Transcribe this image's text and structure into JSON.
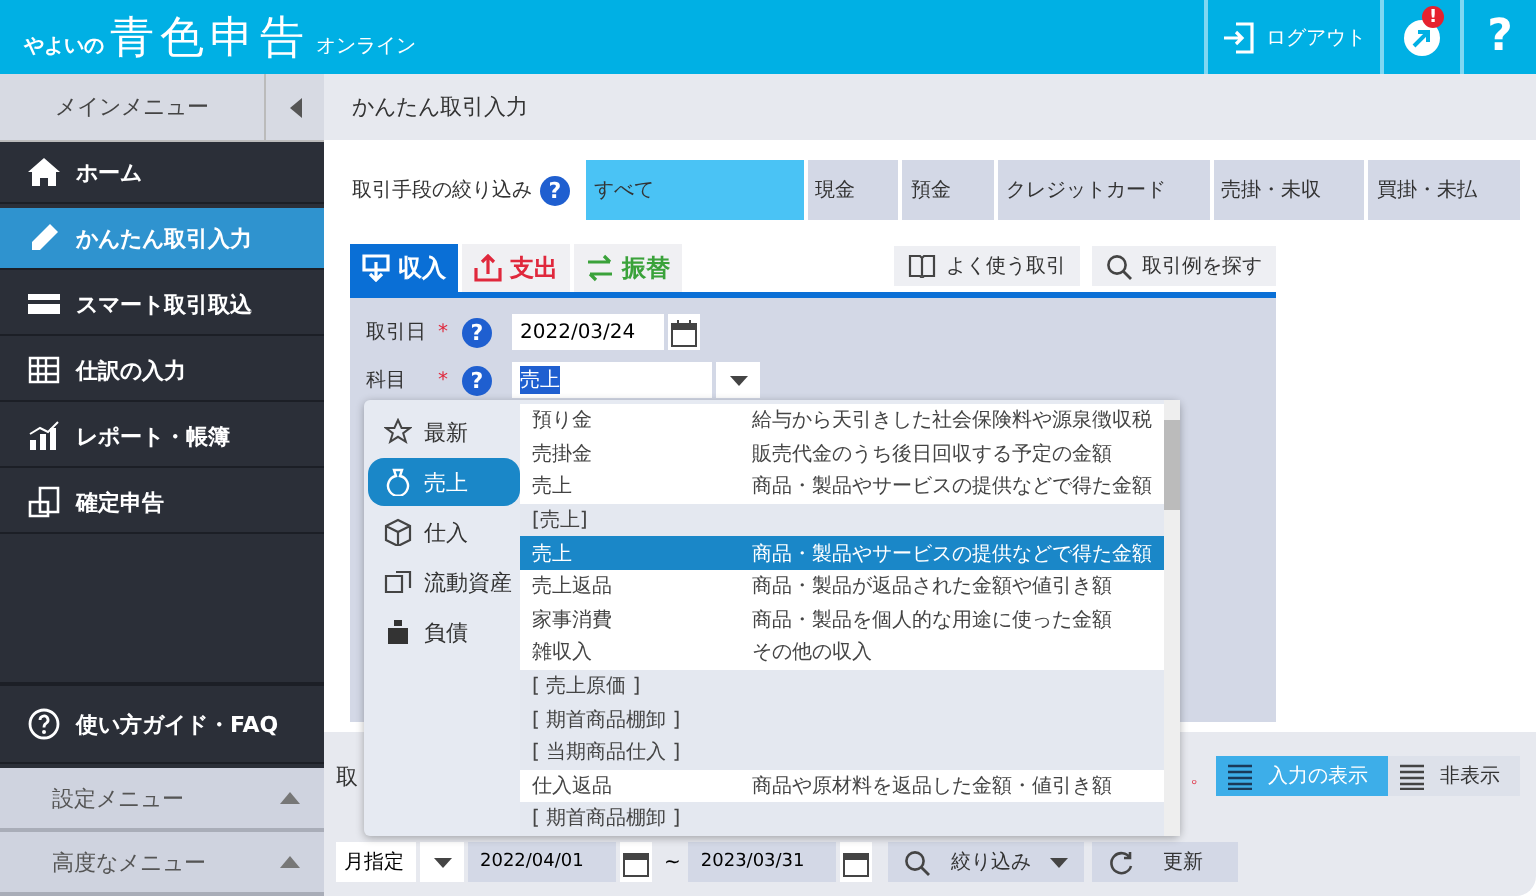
{
  "header": {
    "logo_prefix": "やよいの",
    "logo_main": "青色申告",
    "logo_suffix": "オンライン",
    "logout": "ログアウト",
    "notification_badge": "!",
    "help": "?"
  },
  "sidebar": {
    "title": "メインメニュー",
    "items": [
      {
        "label": "ホーム",
        "selected": false
      },
      {
        "label": "かんたん取引入力",
        "selected": true
      },
      {
        "label": "スマート取引取込",
        "selected": false
      },
      {
        "label": "仕訳の入力",
        "selected": false
      },
      {
        "label": "レポート・帳簿",
        "selected": false
      },
      {
        "label": "確定申告",
        "selected": false
      }
    ],
    "guide": "使い方ガイド・FAQ",
    "menus": [
      "設定メニュー",
      "高度なメニュー"
    ]
  },
  "page_title": "かんたん取引入力",
  "filter": {
    "label": "取引手段の絞り込み",
    "help": "?",
    "options": [
      {
        "label": "すべて",
        "selected": true
      },
      {
        "label": "現金",
        "selected": false
      },
      {
        "label": "預金",
        "selected": false
      },
      {
        "label": "クレジットカード",
        "selected": false
      },
      {
        "label": "売掛・未収",
        "selected": false
      },
      {
        "label": "買掛・未払",
        "selected": false
      }
    ]
  },
  "entry_tabs": [
    {
      "label": "収入",
      "kind": "income",
      "selected": true
    },
    {
      "label": "支出",
      "kind": "expense",
      "selected": false
    },
    {
      "label": "振替",
      "kind": "transfer",
      "selected": false
    }
  ],
  "quick_buttons": [
    "よく使う取引",
    "取引例を探す"
  ],
  "form": [
    {
      "label": "取引日",
      "mark": "*",
      "help": "?",
      "value": "2022/03/24",
      "kind": "date"
    },
    {
      "label": "科目",
      "mark": "*",
      "help": "?",
      "value": "売上",
      "kind": "select"
    }
  ],
  "dropdown": {
    "categories": [
      {
        "label": "最新",
        "selected": false
      },
      {
        "label": "売上",
        "selected": true
      },
      {
        "label": "仕入",
        "selected": false
      },
      {
        "label": "流動資産",
        "selected": false
      },
      {
        "label": "負債",
        "selected": false
      }
    ],
    "rows": [
      {
        "kind": "item",
        "name": "預り金",
        "description": "給与から天引きした社会保険料や源泉徴収税",
        "selected": false
      },
      {
        "kind": "item",
        "name": "売掛金",
        "description": "販売代金のうち後日回収する予定の金額",
        "selected": false
      },
      {
        "kind": "item",
        "name": "売上",
        "description": "商品・製品やサービスの提供などで得た金額",
        "selected": false
      },
      {
        "kind": "group",
        "name": "[売上]",
        "selected": false
      },
      {
        "kind": "item",
        "name": "売上",
        "description": "商品・製品やサービスの提供などで得た金額",
        "selected": true
      },
      {
        "kind": "item",
        "name": "売上返品",
        "description": "商品・製品が返品された金額や値引き額",
        "selected": false
      },
      {
        "kind": "item",
        "name": "家事消費",
        "description": "商品・製品を個人的な用途に使った金額",
        "selected": false
      },
      {
        "kind": "item",
        "name": "雑収入",
        "description": "その他の収入",
        "selected": false
      },
      {
        "kind": "group",
        "name": "[ 売上原価 ]",
        "selected": false
      },
      {
        "kind": "group",
        "name": "[ 期首商品棚卸 ]",
        "selected": false
      },
      {
        "kind": "group",
        "name": "[ 当期商品仕入 ]",
        "selected": false
      },
      {
        "kind": "item",
        "name": "仕入返品",
        "description": "商品や原材料を返品した金額・値引き額",
        "selected": false
      },
      {
        "kind": "group",
        "name": "[ 期首商品棚卸 ]",
        "selected": false
      }
    ]
  },
  "lower": {
    "section_label": "取",
    "note": "。",
    "display_toggle": [
      {
        "label": "入力の表示",
        "selected": true
      },
      {
        "label": "非表示",
        "selected": false
      }
    ],
    "period": {
      "mode": "月指定",
      "start": "2022/04/01",
      "separator": "~",
      "end": "2023/03/31"
    },
    "filter_button": "絞り込み",
    "refresh_button": "更新"
  }
}
